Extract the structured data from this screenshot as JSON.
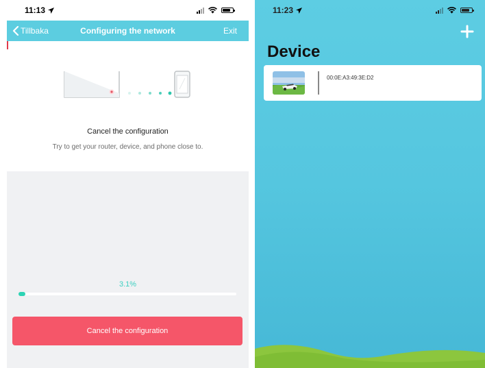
{
  "left_screen": {
    "status": {
      "time": "11:13"
    },
    "nav": {
      "back_label": "Tillbaka",
      "title": "Configuring the network",
      "exit_label": "Exit"
    },
    "config_title": "Cancel the configuration",
    "config_subtitle": "Try to get your router, device, and phone close to.",
    "progress": {
      "label": "3.1%",
      "value_percent": 3.1
    },
    "cancel_button_label": "Cancel the configuration"
  },
  "right_screen": {
    "status": {
      "time": "11:23"
    },
    "heading": "Device",
    "devices": [
      {
        "mac": "00:0E:A3:49:3E:D2"
      }
    ]
  },
  "colors": {
    "accent_cyan": "#5ccde0",
    "progress_teal": "#2dd3b4",
    "cancel_red": "#f55669",
    "hill_green": "#8cc63e"
  },
  "icons": [
    "location-arrow-icon",
    "signal-icon",
    "wifi-icon",
    "battery-icon",
    "chevron-left-icon",
    "plus-icon",
    "router-icon",
    "phone-icon",
    "mower-thumbnail"
  ]
}
